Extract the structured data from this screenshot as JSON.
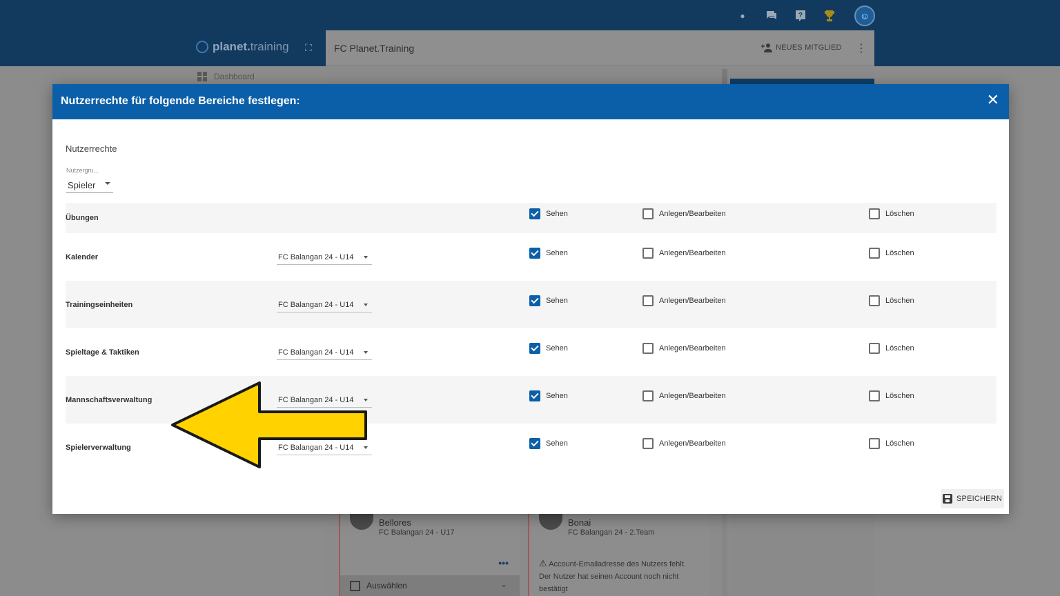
{
  "app": {
    "brand_part1": "planet.",
    "brand_part2": "training",
    "club_title": "FC Planet.Training",
    "new_member_label": "NEUES MITGLIED",
    "sidebar_dashboard": "Dashboard"
  },
  "cards": [
    {
      "name": "Bellores",
      "team": "FC Balangan 24 - U17",
      "select_label": "Auswählen"
    },
    {
      "name": "Bonai",
      "team": "FC Balangan 24 - 2.Team",
      "warning_title": "Account-Emailadresse des Nutzers fehlt.",
      "warning_text": "Der Nutzer hat seinen Account noch nicht bestätigt"
    }
  ],
  "dialog": {
    "title": "Nutzerrechte für folgende Bereiche festlegen:",
    "section_title": "Nutzerrechte",
    "group_label": "Nutzergru...",
    "group_value": "Spieler",
    "save_label": "SPEICHERN",
    "check_labels": {
      "see": "Sehen",
      "edit": "Anlegen/Bearbeiten",
      "delete": "Löschen"
    },
    "rows": [
      {
        "label": "Übungen",
        "team": "",
        "see": true,
        "edit": false,
        "delete": false
      },
      {
        "label": "Kalender",
        "team": "FC Balangan 24 - U14",
        "see": true,
        "edit": false,
        "delete": false
      },
      {
        "label": "Trainingseinheiten",
        "team": "FC Balangan 24 - U14",
        "see": true,
        "edit": false,
        "delete": false
      },
      {
        "label": "Spieltage & Taktiken",
        "team": "FC Balangan 24 - U14",
        "see": true,
        "edit": false,
        "delete": false
      },
      {
        "label": "Mannschaftsverwaltung",
        "team": "FC Balangan 24 - U14",
        "see": true,
        "edit": false,
        "delete": false
      },
      {
        "label": "Spielerverwaltung",
        "team": "FC Balangan 24 - U14",
        "see": true,
        "edit": false,
        "delete": false
      }
    ]
  },
  "colors": {
    "primary": "#0b5fa8",
    "topbar": "#123a5f",
    "arrow_fill": "#ffd200",
    "arrow_stroke": "#1a1a1a"
  }
}
